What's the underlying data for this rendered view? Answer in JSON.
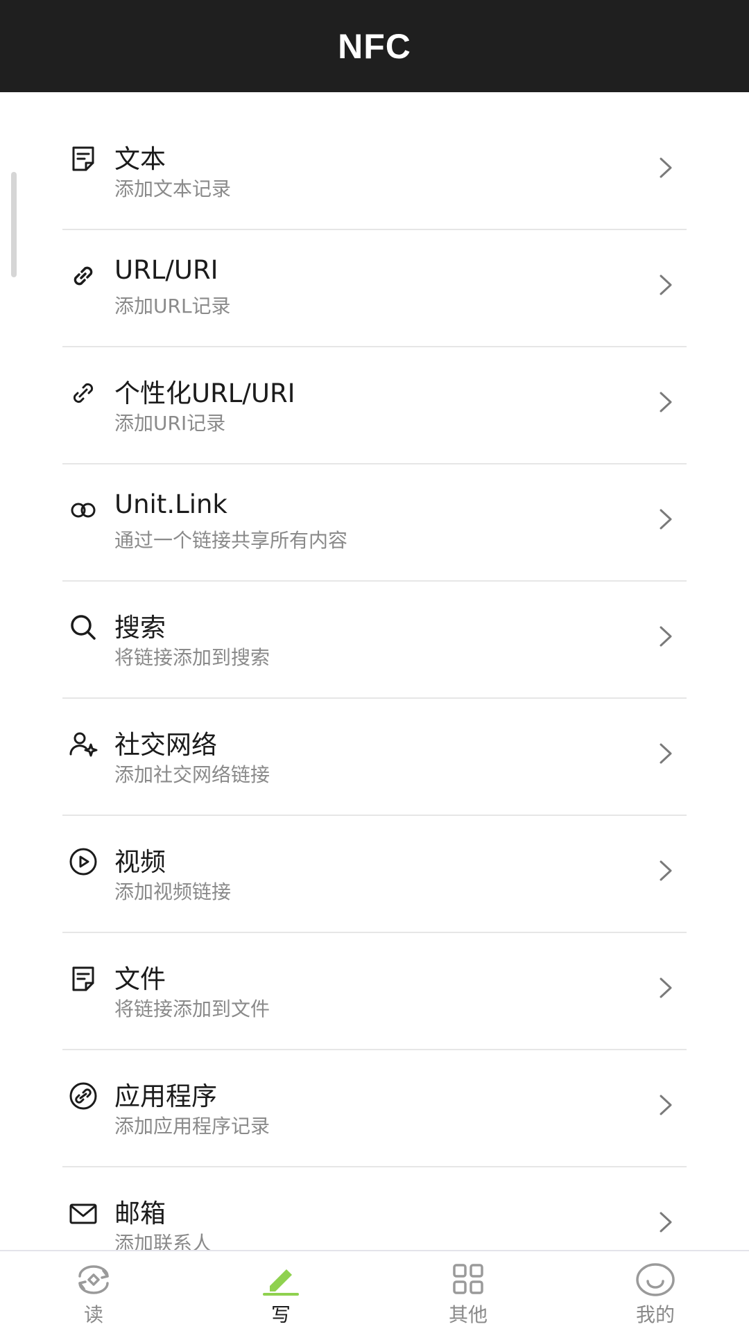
{
  "header": {
    "title": "NFC"
  },
  "colors": {
    "header_bg": "#1f1f1f",
    "accent": "#8fd14f",
    "divider": "#e6e6e6",
    "subtext": "#8a8a8a"
  },
  "list": [
    {
      "title": "文本",
      "subtitle": "添加文本记录",
      "icon": "text-note-icon"
    },
    {
      "title": "URL/URI",
      "subtitle": "添加URL记录",
      "icon": "link-icon"
    },
    {
      "title": "个性化URL/URI",
      "subtitle": "添加URI记录",
      "icon": "custom-link-icon"
    },
    {
      "title": "Unit.Link",
      "subtitle": "通过一个链接共享所有内容",
      "icon": "unit-link-icon"
    },
    {
      "title": "搜索",
      "subtitle": "将链接添加到搜索",
      "icon": "search-icon"
    },
    {
      "title": "社交网络",
      "subtitle": "添加社交网络链接",
      "icon": "social-user-icon"
    },
    {
      "title": "视频",
      "subtitle": "添加视频链接",
      "icon": "video-play-icon"
    },
    {
      "title": "文件",
      "subtitle": "将链接添加到文件",
      "icon": "file-icon"
    },
    {
      "title": "应用程序",
      "subtitle": "添加应用程序记录",
      "icon": "app-icon"
    },
    {
      "title": "邮箱",
      "subtitle": "添加联系人",
      "icon": "mail-icon"
    }
  ],
  "tabs": [
    {
      "label": "读",
      "icon": "read-icon",
      "active": false
    },
    {
      "label": "写",
      "icon": "write-icon",
      "active": true
    },
    {
      "label": "其他",
      "icon": "grid-icon",
      "active": false
    },
    {
      "label": "我的",
      "icon": "profile-smile-icon",
      "active": false
    }
  ]
}
